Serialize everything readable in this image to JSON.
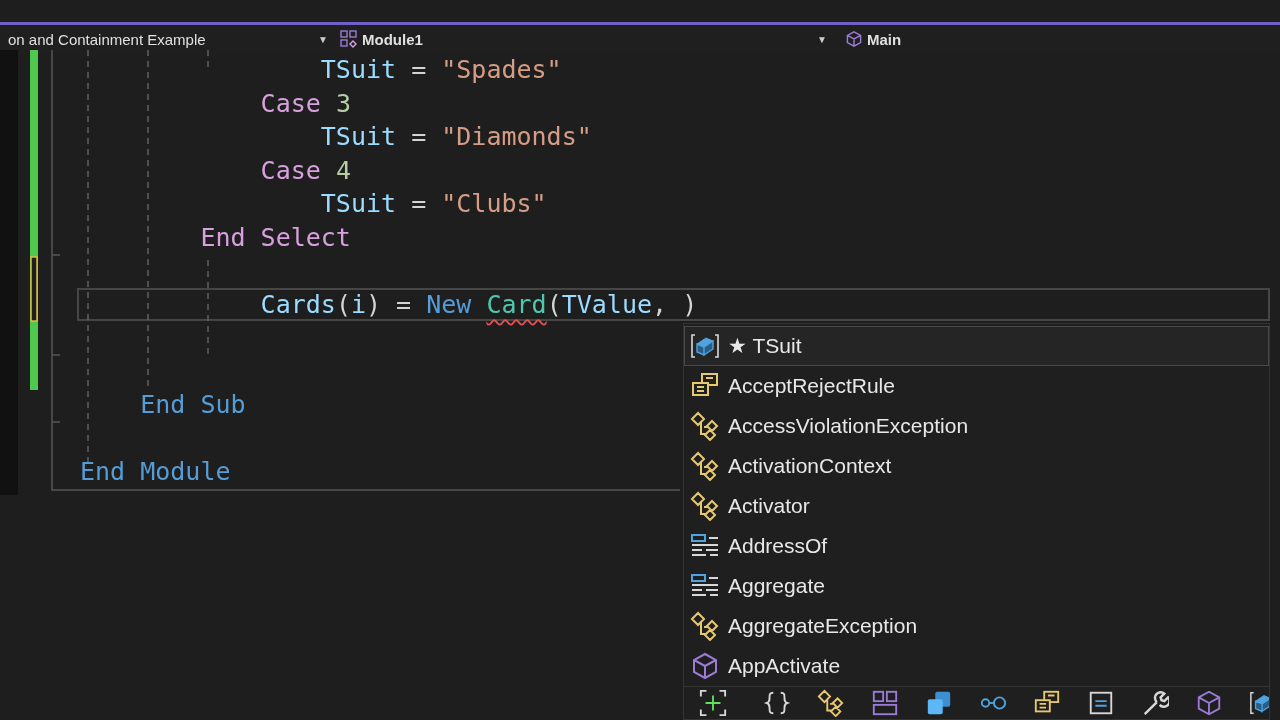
{
  "nav_bar": {
    "project": "on and Containment Example",
    "project_caret": "▼",
    "module": "Module1",
    "module_caret": "▼",
    "member": "Main"
  },
  "code": [
    {
      "children": [
        {
          "children": [
            {
              "children": [
                {
                  "children": [
                    {
                      "current": false,
                      "tokens": [
                        {
                          "kind": "ident",
                          "text": "TSuit"
                        },
                        {
                          "kind": "plain",
                          "text": " = "
                        },
                        {
                          "kind": "string",
                          "text": "\"Spades\""
                        }
                      ]
                    }
                  ]
                },
                {
                  "current": false,
                  "tokens": [
                    {
                      "kind": "control",
                      "text": "Case "
                    },
                    {
                      "kind": "number",
                      "text": "3"
                    }
                  ]
                },
                {
                  "children": [
                    {
                      "current": false,
                      "tokens": [
                        {
                          "kind": "ident",
                          "text": "TSuit"
                        },
                        {
                          "kind": "plain",
                          "text": " = "
                        },
                        {
                          "kind": "string",
                          "text": "\"Diamonds\""
                        }
                      ]
                    }
                  ]
                },
                {
                  "current": false,
                  "tokens": [
                    {
                      "kind": "control",
                      "text": "Case "
                    },
                    {
                      "kind": "number",
                      "text": "4"
                    }
                  ]
                },
                {
                  "children": [
                    {
                      "current": false,
                      "tokens": [
                        {
                          "kind": "ident",
                          "text": "TSuit"
                        },
                        {
                          "kind": "plain",
                          "text": " = "
                        },
                        {
                          "kind": "string",
                          "text": "\"Clubs\""
                        }
                      ]
                    }
                  ]
                }
              ]
            },
            {
              "current": false,
              "tokens": [
                {
                  "kind": "control",
                  "text": "End Select"
                }
              ]
            },
            {
              "current": false
            },
            {
              "children": [
                {
                  "current": true,
                  "tokens": [
                    {
                      "kind": "ident",
                      "text": "Cards"
                    },
                    {
                      "kind": "plain",
                      "text": "("
                    },
                    {
                      "kind": "ident",
                      "text": "i"
                    },
                    {
                      "kind": "plain",
                      "text": ") = "
                    },
                    {
                      "kind": "keyword",
                      "text": "New "
                    },
                    {
                      "kind": "type",
                      "text": "Card",
                      "error": true
                    },
                    {
                      "kind": "plain",
                      "text": "("
                    },
                    {
                      "kind": "ident",
                      "text": "TValue"
                    },
                    {
                      "kind": "plain",
                      "text": ", )"
                    }
                  ]
                }
              ]
            },
            {
              "current": false
            },
            {
              "current": false
            }
          ]
        },
        {
          "current": false,
          "tokens": [
            {
              "kind": "keyword",
              "text": "End Sub"
            }
          ]
        }
      ]
    },
    {
      "current": false
    },
    {
      "current": false,
      "tokens": [
        {
          "kind": "keyword",
          "text": "End Module"
        }
      ]
    }
  ],
  "completion": {
    "items": [
      {
        "kind": "field",
        "label": "★ TSuit",
        "selected": true
      },
      {
        "kind": "enum",
        "label": "AcceptRejectRule",
        "selected": false
      },
      {
        "kind": "class",
        "label": "AccessViolationException",
        "selected": false
      },
      {
        "kind": "class",
        "label": "ActivationContext",
        "selected": false
      },
      {
        "kind": "class",
        "label": "Activator",
        "selected": false
      },
      {
        "kind": "keyword",
        "label": "AddressOf",
        "selected": false
      },
      {
        "kind": "keyword",
        "label": "Aggregate",
        "selected": false
      },
      {
        "kind": "class",
        "label": "AggregateException",
        "selected": false
      },
      {
        "kind": "module",
        "label": "AppActivate",
        "selected": false
      }
    ],
    "filters": [
      {
        "kind": "expand"
      },
      {
        "kind": "namespace"
      },
      {
        "kind": "class"
      },
      {
        "kind": "layout"
      },
      {
        "kind": "squares"
      },
      {
        "kind": "interface"
      },
      {
        "kind": "enum"
      },
      {
        "kind": "document"
      },
      {
        "kind": "wrench"
      },
      {
        "kind": "module"
      },
      {
        "kind": "field"
      }
    ]
  }
}
